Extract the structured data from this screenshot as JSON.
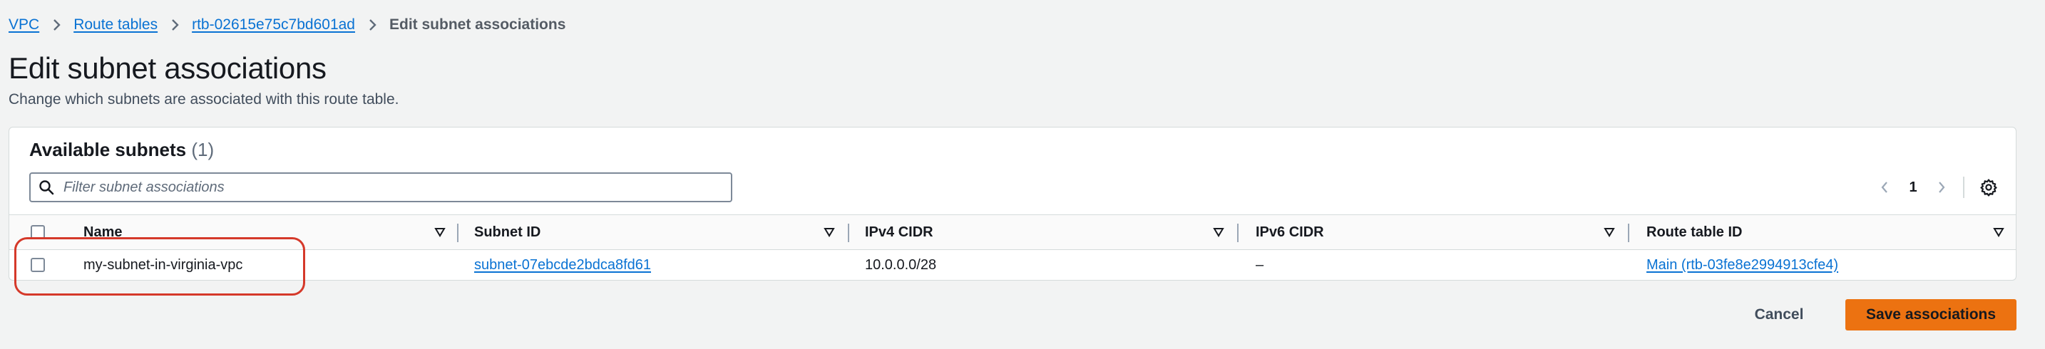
{
  "breadcrumb": {
    "items": [
      {
        "label": "VPC"
      },
      {
        "label": "Route tables"
      },
      {
        "label": "rtb-02615e75c7bd601ad"
      }
    ],
    "current": "Edit subnet associations"
  },
  "page": {
    "title": "Edit subnet associations",
    "description": "Change which subnets are associated with this route table."
  },
  "panel": {
    "title": "Available subnets",
    "count": "(1)",
    "filter_placeholder": "Filter subnet associations",
    "pagination": {
      "current_page": "1"
    }
  },
  "table": {
    "columns": [
      {
        "label": "Name"
      },
      {
        "label": "Subnet ID"
      },
      {
        "label": "IPv4 CIDR"
      },
      {
        "label": "IPv6 CIDR"
      },
      {
        "label": "Route table ID"
      }
    ],
    "rows": [
      {
        "selected": false,
        "name": "my-subnet-in-virginia-vpc",
        "subnet_id": "subnet-07ebcde2bdca8fd61",
        "ipv4_cidr": "10.0.0.0/28",
        "ipv6_cidr": "–",
        "route_table_id": "Main (rtb-03fe8e2994913cfe4)"
      }
    ]
  },
  "actions": {
    "cancel": "Cancel",
    "save": "Save associations"
  },
  "colors": {
    "link": "#0972d3",
    "primary_button": "#ec7211",
    "highlight": "#d5392a"
  },
  "icons": [
    "chevron-right-icon",
    "search-icon",
    "chevron-left-icon",
    "gear-icon",
    "sort-caret-icon"
  ]
}
